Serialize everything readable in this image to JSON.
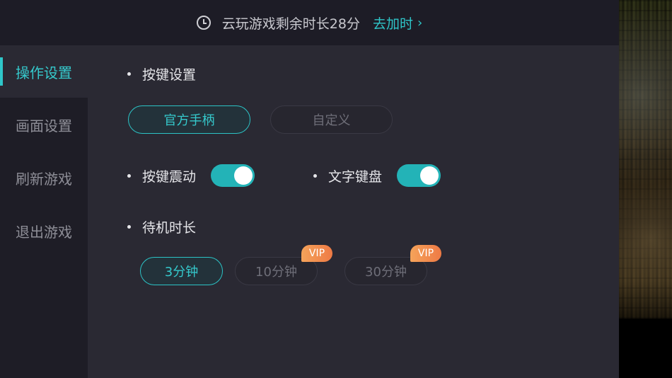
{
  "topbar": {
    "remaining_text": "云玩游戏剩余时长28分",
    "add_time_label": "去加时",
    "chevron": "›"
  },
  "sidebar": {
    "items": [
      {
        "label": "操作设置",
        "active": true
      },
      {
        "label": "画面设置",
        "active": false
      },
      {
        "label": "刷新游戏",
        "active": false
      },
      {
        "label": "退出游戏",
        "active": false
      }
    ]
  },
  "settings": {
    "key_settings": {
      "title": "按键设置",
      "options": [
        {
          "label": "官方手柄",
          "selected": true
        },
        {
          "label": "自定义",
          "selected": false
        }
      ]
    },
    "vibration": {
      "label": "按键震动",
      "enabled": true
    },
    "text_keyboard": {
      "label": "文字键盘",
      "enabled": true
    },
    "idle_time": {
      "title": "待机时长",
      "options": [
        {
          "label": "3分钟",
          "selected": true,
          "badge": ""
        },
        {
          "label": "10分钟",
          "selected": false,
          "badge": "VIP"
        },
        {
          "label": "30分钟",
          "selected": false,
          "badge": "VIP"
        }
      ]
    }
  },
  "colors": {
    "accent": "#2fc6c9",
    "panel_bg": "#2a2933",
    "sidebar_bg": "#1e1d26",
    "vip_gradient_start": "#f5a35a",
    "vip_gradient_end": "#ee7a45"
  }
}
